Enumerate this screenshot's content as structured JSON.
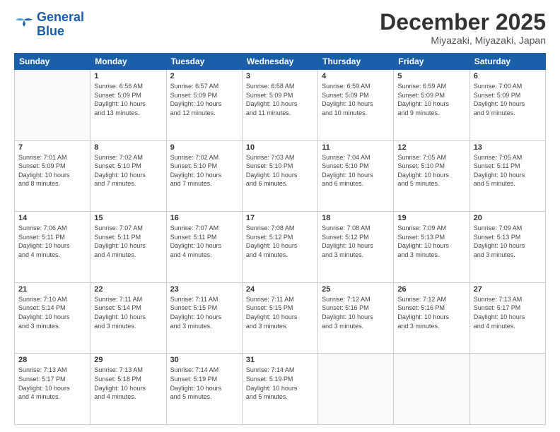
{
  "logo": {
    "line1": "General",
    "line2": "Blue"
  },
  "header": {
    "month": "December 2025",
    "location": "Miyazaki, Miyazaki, Japan"
  },
  "weekdays": [
    "Sunday",
    "Monday",
    "Tuesday",
    "Wednesday",
    "Thursday",
    "Friday",
    "Saturday"
  ],
  "weeks": [
    [
      {
        "day": "",
        "info": ""
      },
      {
        "day": "1",
        "info": "Sunrise: 6:56 AM\nSunset: 5:09 PM\nDaylight: 10 hours\nand 13 minutes."
      },
      {
        "day": "2",
        "info": "Sunrise: 6:57 AM\nSunset: 5:09 PM\nDaylight: 10 hours\nand 12 minutes."
      },
      {
        "day": "3",
        "info": "Sunrise: 6:58 AM\nSunset: 5:09 PM\nDaylight: 10 hours\nand 11 minutes."
      },
      {
        "day": "4",
        "info": "Sunrise: 6:59 AM\nSunset: 5:09 PM\nDaylight: 10 hours\nand 10 minutes."
      },
      {
        "day": "5",
        "info": "Sunrise: 6:59 AM\nSunset: 5:09 PM\nDaylight: 10 hours\nand 9 minutes."
      },
      {
        "day": "6",
        "info": "Sunrise: 7:00 AM\nSunset: 5:09 PM\nDaylight: 10 hours\nand 9 minutes."
      }
    ],
    [
      {
        "day": "7",
        "info": "Sunrise: 7:01 AM\nSunset: 5:09 PM\nDaylight: 10 hours\nand 8 minutes."
      },
      {
        "day": "8",
        "info": "Sunrise: 7:02 AM\nSunset: 5:10 PM\nDaylight: 10 hours\nand 7 minutes."
      },
      {
        "day": "9",
        "info": "Sunrise: 7:02 AM\nSunset: 5:10 PM\nDaylight: 10 hours\nand 7 minutes."
      },
      {
        "day": "10",
        "info": "Sunrise: 7:03 AM\nSunset: 5:10 PM\nDaylight: 10 hours\nand 6 minutes."
      },
      {
        "day": "11",
        "info": "Sunrise: 7:04 AM\nSunset: 5:10 PM\nDaylight: 10 hours\nand 6 minutes."
      },
      {
        "day": "12",
        "info": "Sunrise: 7:05 AM\nSunset: 5:10 PM\nDaylight: 10 hours\nand 5 minutes."
      },
      {
        "day": "13",
        "info": "Sunrise: 7:05 AM\nSunset: 5:11 PM\nDaylight: 10 hours\nand 5 minutes."
      }
    ],
    [
      {
        "day": "14",
        "info": "Sunrise: 7:06 AM\nSunset: 5:11 PM\nDaylight: 10 hours\nand 4 minutes."
      },
      {
        "day": "15",
        "info": "Sunrise: 7:07 AM\nSunset: 5:11 PM\nDaylight: 10 hours\nand 4 minutes."
      },
      {
        "day": "16",
        "info": "Sunrise: 7:07 AM\nSunset: 5:11 PM\nDaylight: 10 hours\nand 4 minutes."
      },
      {
        "day": "17",
        "info": "Sunrise: 7:08 AM\nSunset: 5:12 PM\nDaylight: 10 hours\nand 4 minutes."
      },
      {
        "day": "18",
        "info": "Sunrise: 7:08 AM\nSunset: 5:12 PM\nDaylight: 10 hours\nand 3 minutes."
      },
      {
        "day": "19",
        "info": "Sunrise: 7:09 AM\nSunset: 5:13 PM\nDaylight: 10 hours\nand 3 minutes."
      },
      {
        "day": "20",
        "info": "Sunrise: 7:09 AM\nSunset: 5:13 PM\nDaylight: 10 hours\nand 3 minutes."
      }
    ],
    [
      {
        "day": "21",
        "info": "Sunrise: 7:10 AM\nSunset: 5:14 PM\nDaylight: 10 hours\nand 3 minutes."
      },
      {
        "day": "22",
        "info": "Sunrise: 7:11 AM\nSunset: 5:14 PM\nDaylight: 10 hours\nand 3 minutes."
      },
      {
        "day": "23",
        "info": "Sunrise: 7:11 AM\nSunset: 5:15 PM\nDaylight: 10 hours\nand 3 minutes."
      },
      {
        "day": "24",
        "info": "Sunrise: 7:11 AM\nSunset: 5:15 PM\nDaylight: 10 hours\nand 3 minutes."
      },
      {
        "day": "25",
        "info": "Sunrise: 7:12 AM\nSunset: 5:16 PM\nDaylight: 10 hours\nand 3 minutes."
      },
      {
        "day": "26",
        "info": "Sunrise: 7:12 AM\nSunset: 5:16 PM\nDaylight: 10 hours\nand 3 minutes."
      },
      {
        "day": "27",
        "info": "Sunrise: 7:13 AM\nSunset: 5:17 PM\nDaylight: 10 hours\nand 4 minutes."
      }
    ],
    [
      {
        "day": "28",
        "info": "Sunrise: 7:13 AM\nSunset: 5:17 PM\nDaylight: 10 hours\nand 4 minutes."
      },
      {
        "day": "29",
        "info": "Sunrise: 7:13 AM\nSunset: 5:18 PM\nDaylight: 10 hours\nand 4 minutes."
      },
      {
        "day": "30",
        "info": "Sunrise: 7:14 AM\nSunset: 5:19 PM\nDaylight: 10 hours\nand 5 minutes."
      },
      {
        "day": "31",
        "info": "Sunrise: 7:14 AM\nSunset: 5:19 PM\nDaylight: 10 hours\nand 5 minutes."
      },
      {
        "day": "",
        "info": ""
      },
      {
        "day": "",
        "info": ""
      },
      {
        "day": "",
        "info": ""
      }
    ]
  ]
}
